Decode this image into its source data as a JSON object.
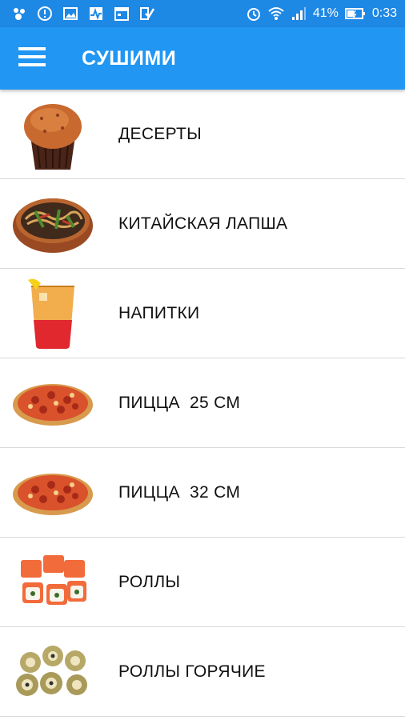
{
  "status_bar": {
    "battery": "41%",
    "time": "0:33",
    "left_icons": [
      "app-icon",
      "alert-icon",
      "image-icon",
      "activity-icon",
      "calendar-icon",
      "check-icon"
    ],
    "right_icons": [
      "alarm-icon",
      "wifi-icon",
      "signal-icon",
      "battery-icon"
    ]
  },
  "header": {
    "title": "СУШИМИ",
    "menu_icon": "hamburger-menu-icon"
  },
  "categories": [
    {
      "label": "ДЕСЕРТЫ",
      "image": "muffin"
    },
    {
      "label": "КИТАЙСКАЯ ЛАПША",
      "image": "noodle-bowl"
    },
    {
      "label": "НАПИТКИ",
      "image": "drink-glass"
    },
    {
      "label": "ПИЦЦА  25 СМ",
      "image": "pizza"
    },
    {
      "label": "ПИЦЦА  32 СМ",
      "image": "pizza"
    },
    {
      "label": "РОЛЛЫ",
      "image": "salmon-rolls"
    },
    {
      "label": "РОЛЛЫ ГОРЯЧИЕ",
      "image": "hot-rolls"
    }
  ],
  "colors": {
    "app_bar": "#2196f3",
    "status_bar": "#1e88e5",
    "divider": "#d9d9d9"
  }
}
